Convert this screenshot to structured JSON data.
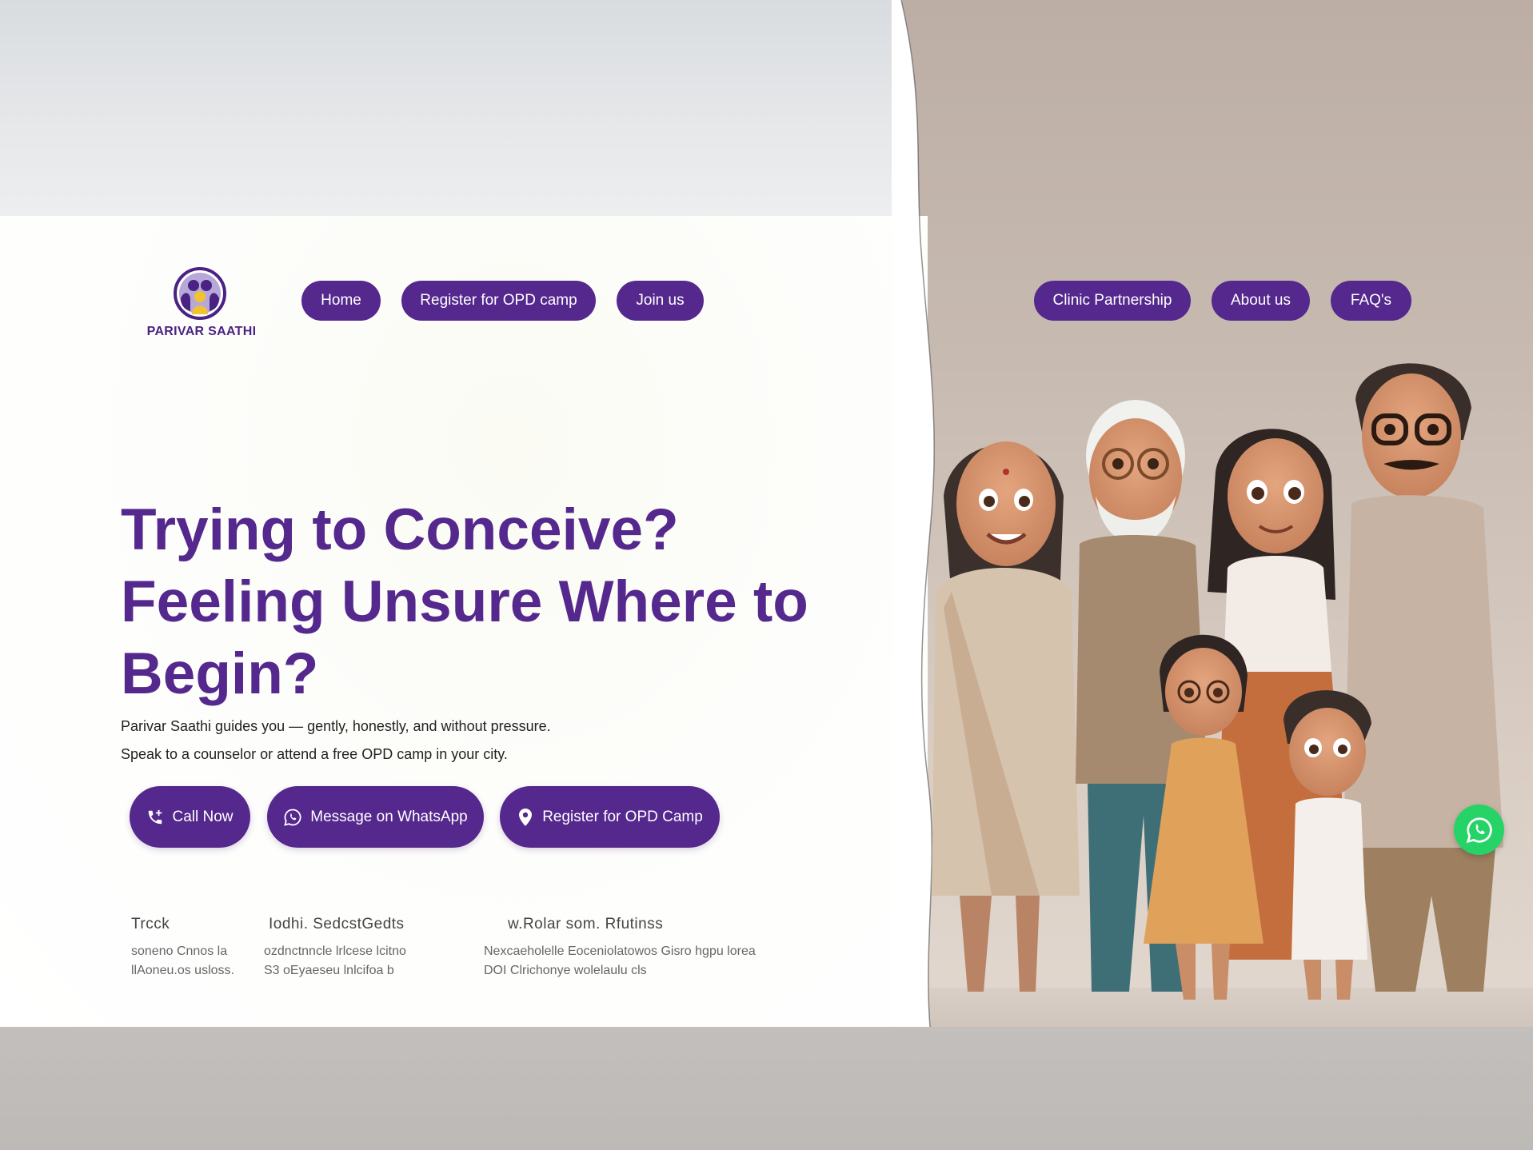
{
  "brand": {
    "name": "PARIVAR SAATHI",
    "primary": "#55288e",
    "whatsapp": "#26d366"
  },
  "nav": {
    "left": [
      {
        "label": "Home"
      },
      {
        "label": "Register for OPD camp"
      },
      {
        "label": "Join us"
      }
    ],
    "right": [
      {
        "label": "Clinic Partnership"
      },
      {
        "label": "About us"
      },
      {
        "label": "FAQ's"
      }
    ]
  },
  "hero": {
    "title_lines": [
      "Trying to Conceive?",
      "Feeling Unsure Where to",
      "Begin?"
    ],
    "subtitle_lines": [
      "Parivar Saathi guides you — gently, honestly, and without pressure.",
      "Speak to a counselor or attend a free OPD camp in your city."
    ]
  },
  "cta": [
    {
      "label": "Call Now",
      "icon": "phone-icon"
    },
    {
      "label": "Message on WhatsApp",
      "icon": "whatsapp-icon"
    },
    {
      "label": "Register for OPD Camp",
      "icon": "location-pin-icon"
    }
  ],
  "features": {
    "titles": [
      "Trcck",
      "Iodhi. SedcstGedts",
      "w.Rolar som. Rfutinss"
    ],
    "descs": [
      [
        "soneno Cnnos la",
        "llAoneu.os usloss."
      ],
      [
        "ozdnctnncle lrlcese lcitno",
        "S3 oEyaeseu lnlcifoa b"
      ],
      [
        "Nexcaeholelle Eoceniolatowos Gisro hgpu lorea",
        "DOI Clrichonye wolelaulu cls"
      ]
    ]
  },
  "floating": {
    "icon": "whatsapp-icon"
  }
}
